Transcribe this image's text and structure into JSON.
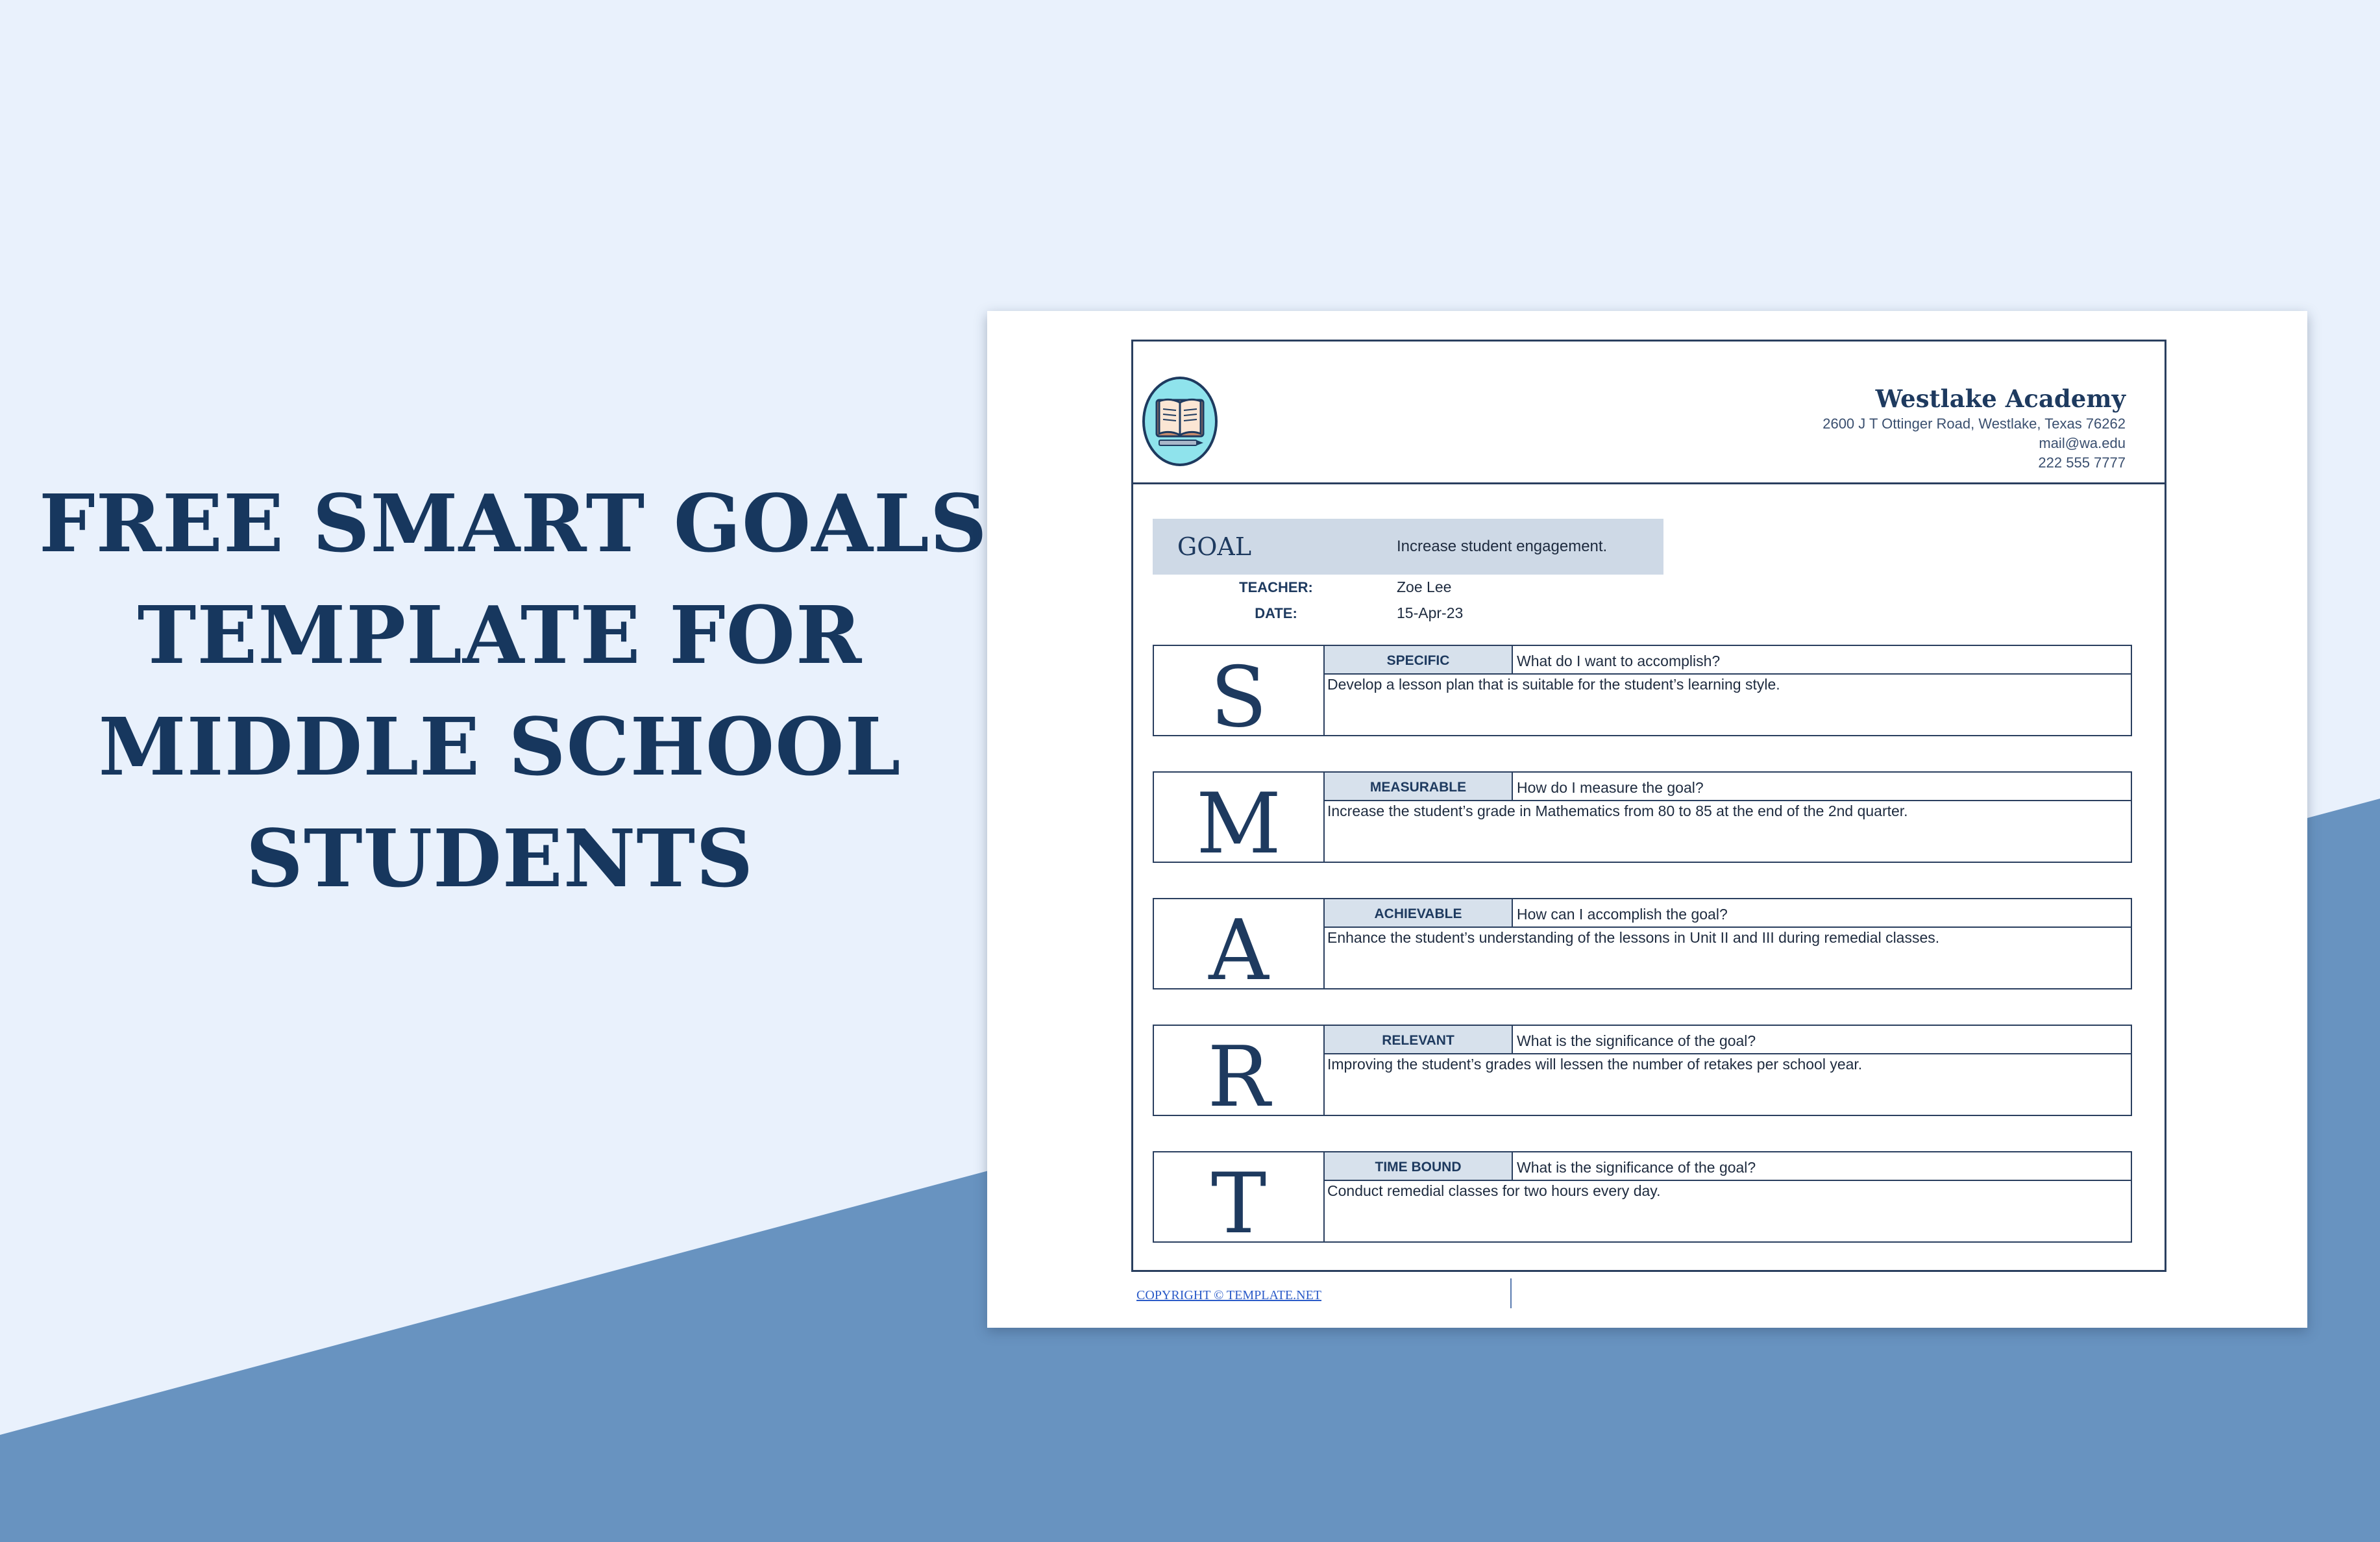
{
  "colors": {
    "page_bg": "#e9f1fc",
    "band": "#6893c0",
    "title": "#17375e",
    "label_fill": "#d7e1ec",
    "goal_fill": "#ced9e6"
  },
  "promo": {
    "title_lines": [
      "FREE SMART GOALS",
      "TEMPLATE FOR",
      "MIDDLE SCHOOL",
      "STUDENTS"
    ]
  },
  "document": {
    "logo_icon": "open-book-icon",
    "school": {
      "name": "Westlake Academy",
      "address": "2600 J T Ottinger Road, Westlake, Texas 76262",
      "email": "mail@wa.edu",
      "phone": "222 555 7777"
    },
    "goal": {
      "label": "GOAL",
      "value": "Increase student engagement."
    },
    "teacher": {
      "label": "TEACHER:",
      "value": "Zoe Lee"
    },
    "date": {
      "label": "DATE:",
      "value": "15-Apr-23"
    },
    "smart": [
      {
        "letter": "S",
        "label": "SPECIFIC",
        "question": "What do I want to accomplish?",
        "answer": "Develop a lesson plan that is suitable for the student’s learning style."
      },
      {
        "letter": "M",
        "label": "MEASURABLE",
        "question": "How do I measure the goal?",
        "answer": "Increase the student’s grade in Mathematics from 80 to 85 at the end of the 2nd quarter."
      },
      {
        "letter": "A",
        "label": "ACHIEVABLE",
        "question": "How can I accomplish the goal?",
        "answer": "Enhance the student’s understanding of the lessons in Unit II and III during remedial classes."
      },
      {
        "letter": "R",
        "label": "RELEVANT",
        "question": "What is the significance of the goal?",
        "answer": "Improving the student’s grades will lessen the number of retakes per school year."
      },
      {
        "letter": "T",
        "label": "TIME BOUND",
        "question": "What is the significance of the goal?",
        "answer": "Conduct remedial classes for two hours every day."
      }
    ],
    "copyright": "COPYRIGHT © TEMPLATE.NET"
  }
}
